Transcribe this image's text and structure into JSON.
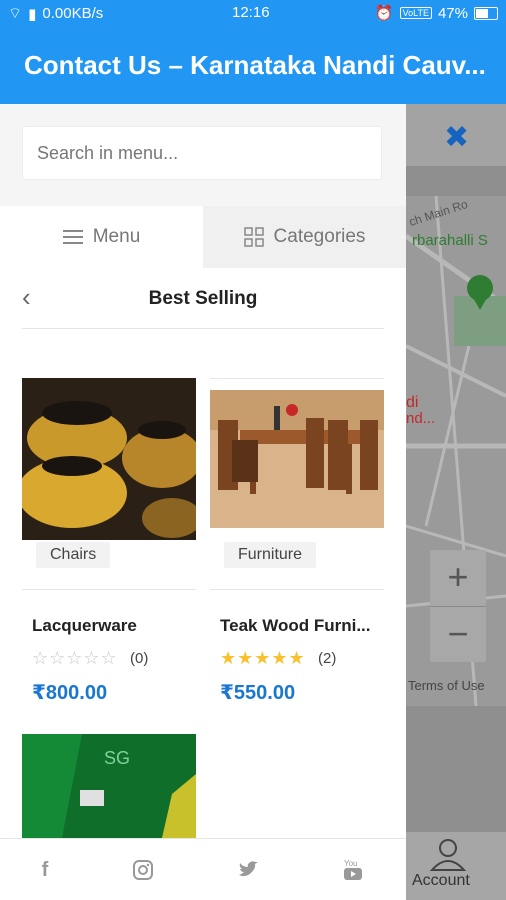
{
  "status": {
    "speed": "0.00KB/s",
    "time": "12:16",
    "battery": "47%",
    "volte": "VoLTE"
  },
  "appbar": {
    "title": "Contact Us – Karnataka Nandi Cauv..."
  },
  "search": {
    "placeholder": "Search in menu..."
  },
  "tabs": [
    {
      "label": "Menu",
      "icon": "hamburger-icon"
    },
    {
      "label": "Categories",
      "icon": "grid-icon"
    }
  ],
  "section": {
    "title": "Best Selling"
  },
  "products": [
    {
      "name": "Lacquerware",
      "category": "Chairs",
      "price": "₹800.00",
      "rating": 0,
      "reviews": "(0)"
    },
    {
      "name": "Teak Wood Furni...",
      "category": "Furniture",
      "price": "₹550.00",
      "rating": 4.5,
      "reviews": "(2)"
    }
  ],
  "social": [
    "facebook-icon",
    "instagram-icon",
    "twitter-icon",
    "youtube-icon"
  ],
  "map": {
    "terms": "Terms of Use",
    "road1": "ch Main Ro",
    "road2": "rbarahalli S",
    "place1": "di",
    "place2": "nd..."
  },
  "zoom": {
    "in": "+",
    "out": "−"
  },
  "account": {
    "label": "Account"
  },
  "colors": {
    "primary": "#2196f3",
    "price": "#1976d2",
    "star": "#fbc02d"
  }
}
